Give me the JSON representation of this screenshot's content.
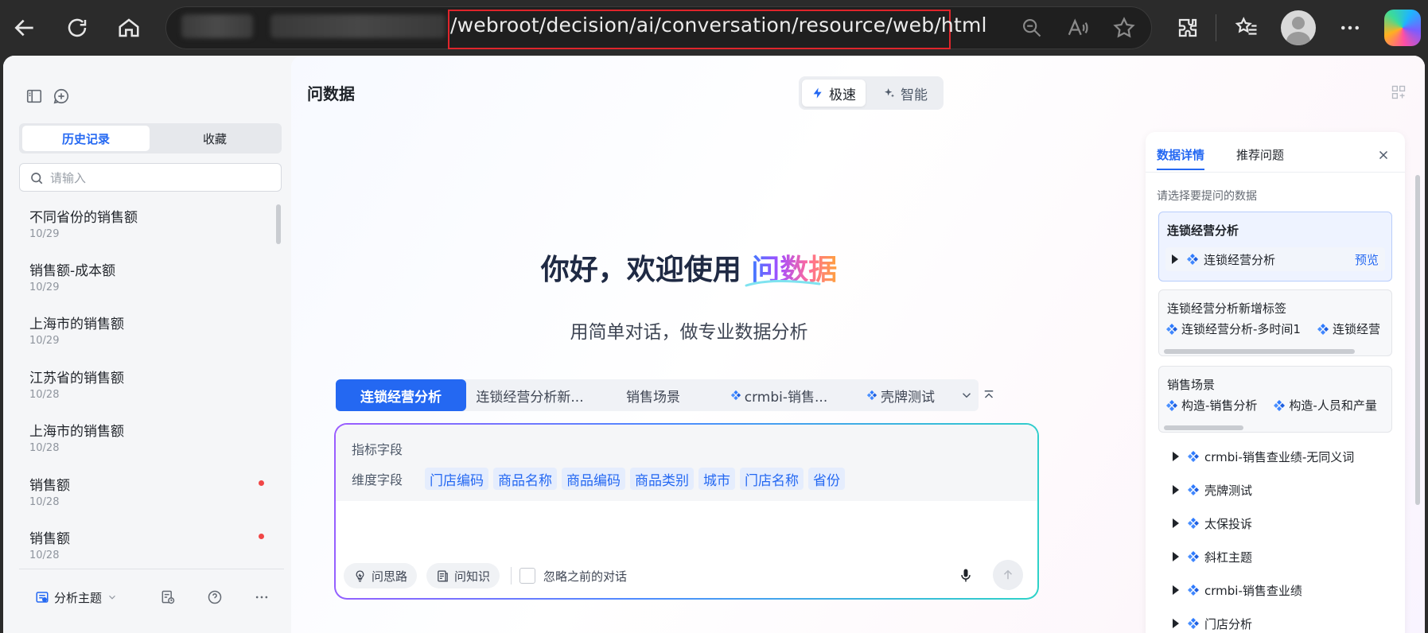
{
  "browser": {
    "url": "/webroot/decision/ai/conversation/resource/web/html"
  },
  "sidebar": {
    "tabs": [
      {
        "label": "历史记录",
        "active": true
      },
      {
        "label": "收藏",
        "active": false
      }
    ],
    "search_placeholder": "请输入",
    "history": [
      {
        "title": "不同省份的销售额",
        "date": "10/29",
        "unread": false
      },
      {
        "title": "销售额-成本额",
        "date": "10/29",
        "unread": false
      },
      {
        "title": "上海市的销售额",
        "date": "10/29",
        "unread": false
      },
      {
        "title": "江苏省的销售额",
        "date": "10/28",
        "unread": false
      },
      {
        "title": "上海市的销售额",
        "date": "10/28",
        "unread": false
      },
      {
        "title": "销售额",
        "date": "10/28",
        "unread": true
      },
      {
        "title": "销售额",
        "date": "10/28",
        "unread": true
      }
    ],
    "footer": {
      "topic_label": "分析主题"
    }
  },
  "main": {
    "title": "问数据",
    "modes": [
      {
        "label": "极速",
        "active": true
      },
      {
        "label": "智能",
        "active": false
      }
    ],
    "welcome_prefix": "你好，欢迎使用",
    "welcome_brand": "问数据",
    "subtitle": "用简单对话，做专业数据分析",
    "dataset_tabs": [
      {
        "label": "连锁经营分析",
        "active": true,
        "icon": false
      },
      {
        "label": "连锁经营分析新...",
        "active": false,
        "icon": false
      },
      {
        "label": "销售场景",
        "active": false,
        "icon": false
      },
      {
        "label": "crmbi-销售...",
        "active": false,
        "icon": true
      },
      {
        "label": "壳牌测试",
        "active": false,
        "icon": true
      }
    ],
    "metric_label": "指标字段",
    "dimension_label": "维度字段",
    "dimension_fields": [
      "门店编码",
      "商品名称",
      "商品编码",
      "商品类别",
      "城市",
      "门店名称",
      "省份"
    ],
    "pills": [
      {
        "label": "问思路",
        "icon": "bulb-icon"
      },
      {
        "label": "问知识",
        "icon": "book-icon"
      }
    ],
    "ignore_history_label": "忽略之前的对话"
  },
  "right_panel": {
    "tabs": [
      {
        "label": "数据详情",
        "active": true
      },
      {
        "label": "推荐问题",
        "active": false
      }
    ],
    "hint": "请选择要提问的数据",
    "selected_card": {
      "title": "连锁经营分析",
      "item": "连锁经营分析",
      "preview_label": "预览"
    },
    "card2": {
      "title": "连锁经营分析新增标签",
      "items": [
        "连锁经营分析-多时间1",
        "连锁经营"
      ]
    },
    "card3": {
      "title": "销售场景",
      "items": [
        "构造-销售分析",
        "构造-人员和产量"
      ]
    },
    "tree": [
      "crmbi-销售查业绩-无同义词",
      "壳牌测试",
      "太保投诉",
      "斜杠主题",
      "crmbi-销售查业绩",
      "门店分析"
    ]
  },
  "colors": {
    "accent": "#2468f2",
    "unread_dot": "#f04646",
    "url_highlight": "#e0252b"
  }
}
